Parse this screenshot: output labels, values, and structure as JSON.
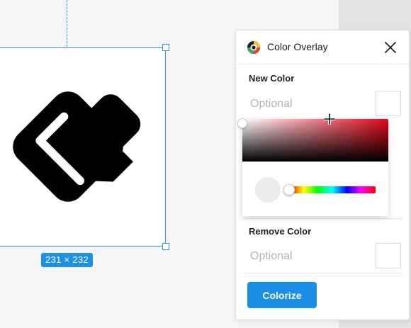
{
  "canvas": {
    "selection_size": "231 × 232",
    "logo_icon": "check-diamond-logo"
  },
  "panel": {
    "title": "Color Overlay",
    "icon": "color-wheel-icon",
    "close_icon": "close-icon",
    "new_color": {
      "label": "New Color",
      "placeholder": "Optional",
      "value": ""
    },
    "remove_color": {
      "label": "Remove Color",
      "placeholder": "Optional",
      "value": ""
    },
    "colorize_label": "Colorize"
  },
  "picker": {
    "hue_color": "#e1061a",
    "selected_color": "#ffffff"
  },
  "colors": {
    "accent": "#1a8fe8",
    "selection": "#2f97e0"
  }
}
